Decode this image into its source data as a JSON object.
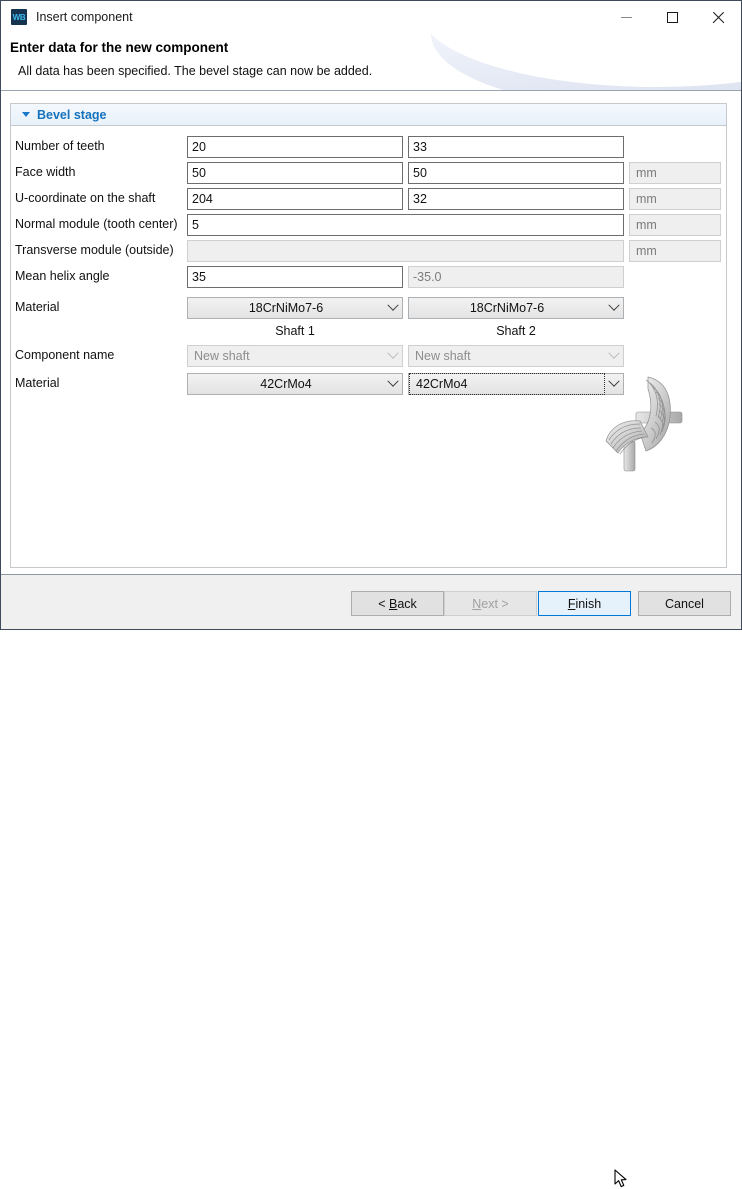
{
  "window": {
    "icon_label": "WB",
    "title": "Insert component",
    "controls": {
      "minimize": "minimize-button",
      "maximize": "maximize-button",
      "close": "close-button"
    }
  },
  "header": {
    "title": "Enter data for the new component",
    "subtitle": "All data has been specified. The bevel stage can now be added."
  },
  "group": {
    "title": "Bevel stage",
    "expanded": true
  },
  "shaft_headers": {
    "shaft1": "Shaft 1",
    "shaft2": "Shaft 2"
  },
  "rows": [
    {
      "label": "Number of teeth",
      "v1": "20",
      "v2": "33",
      "unit": ""
    },
    {
      "label": "Face width",
      "v1": "50",
      "v2": "50",
      "unit": "mm"
    },
    {
      "label": "U-coordinate on the shaft",
      "v1": "204",
      "v2": "32",
      "unit": "mm"
    },
    {
      "label": "Normal module (tooth center)",
      "v1": "5",
      "v2": "",
      "unit": "mm"
    },
    {
      "label": "Transverse module (outside)",
      "v1": "",
      "v2": "",
      "unit": "mm"
    },
    {
      "label": "Mean helix angle",
      "v1": "35",
      "v2": "-35.0",
      "unit": ""
    }
  ],
  "material_row": {
    "label": "Material",
    "v1": "18CrNiMo7-6",
    "v2": "18CrNiMo7-6"
  },
  "component_name_row": {
    "label": "Component name",
    "v1": "New shaft",
    "v2": "New shaft"
  },
  "shaft_material_row": {
    "label": "Material",
    "v1": "42CrMo4",
    "v2": "42CrMo4"
  },
  "footer": {
    "back": "< Back",
    "back_mnemonic": "B",
    "next": "Next >",
    "next_mnemonic": "N",
    "finish": "Finish",
    "finish_mnemonic": "F",
    "cancel": "Cancel"
  },
  "colors": {
    "accent": "#1672bd",
    "focus_blue": "#0078d7",
    "hover_fill": "#e5f2fc",
    "icon_bg": "#16344f",
    "icon_fg": "#3fbcf0"
  }
}
